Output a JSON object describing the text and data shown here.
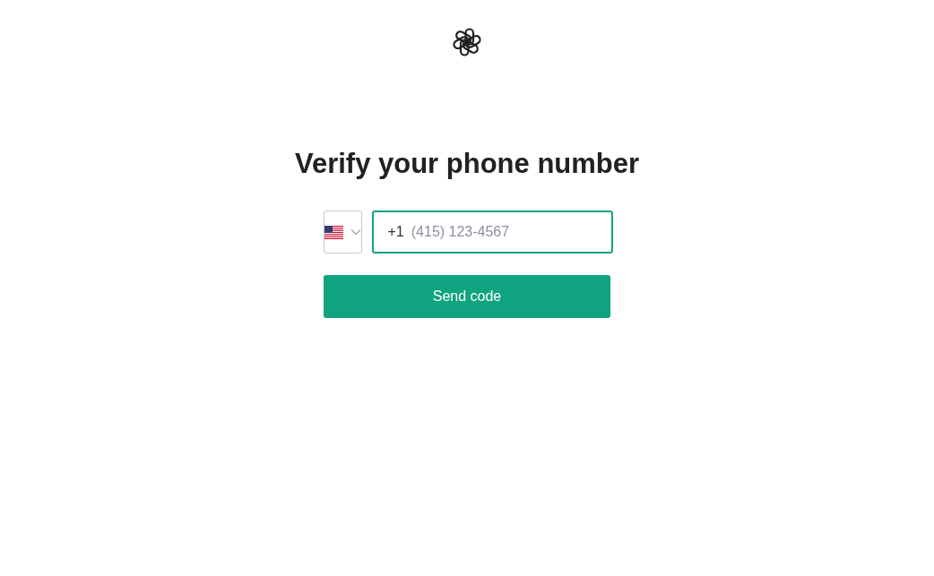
{
  "title": "Verify your phone number",
  "country_select": {
    "kind": "flag"
  },
  "phone_field": {
    "prefix": "+1",
    "placeholder": "(415) 123-4567",
    "focused": true
  },
  "send_button": {
    "label": "Send code"
  }
}
